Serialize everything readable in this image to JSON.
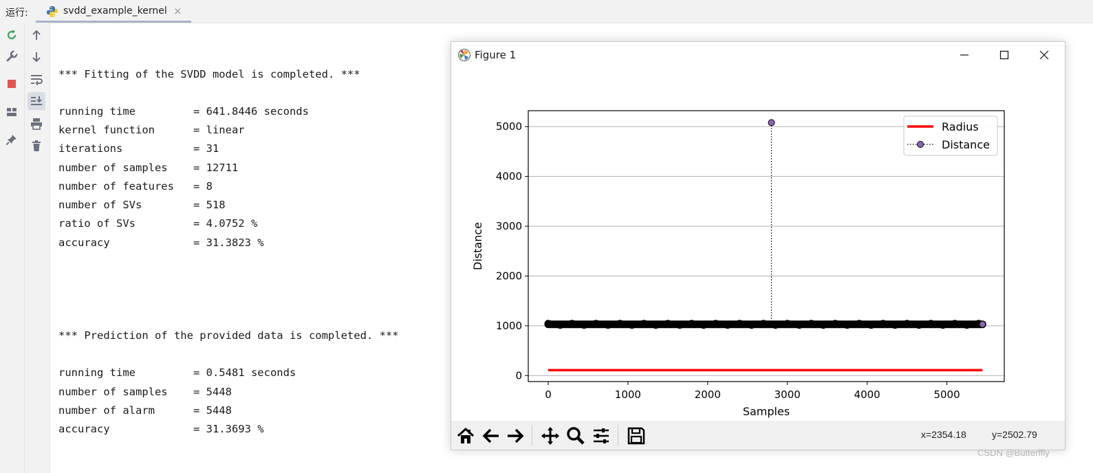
{
  "run_panel": {
    "label": "运行:",
    "tab": {
      "title": "svdd_example_kernel",
      "close": "×"
    }
  },
  "toolbar_left": [
    "rerun-icon",
    "wrench-icon",
    "stop-icon",
    "layout-icon",
    "pin-icon"
  ],
  "toolbar_right": [
    "arrow-up-icon",
    "arrow-down-icon",
    "soft-wrap-icon",
    "scroll-to-end-icon",
    "print-icon",
    "trash-icon"
  ],
  "console": {
    "fit_header": "*** Fitting of the SVDD model is completed. ***",
    "fit_lines": [
      "running time         = 641.8446 seconds",
      "kernel function      = linear",
      "iterations           = 31",
      "number of samples    = 12711",
      "number of features   = 8",
      "number of SVs        = 518",
      "ratio of SVs         = 4.0752 %",
      "accuracy             = 31.3823 %"
    ],
    "pred_header": "*** Prediction of the provided data is completed. ***",
    "pred_lines": [
      "running time         = 0.5481 seconds",
      "number of samples    = 5448",
      "number of alarm      = 5448",
      "accuracy             = 31.3693 %"
    ]
  },
  "figure": {
    "title": "Figure 1",
    "coords": {
      "x": "x=2354.18",
      "y": "y=2502.79"
    },
    "toolbar": [
      "home-icon",
      "back-icon",
      "forward-icon",
      "pan-icon",
      "zoom-icon",
      "configure-icon",
      "save-icon"
    ]
  },
  "chart_data": {
    "type": "line",
    "xlabel": "Samples",
    "ylabel": "Distance",
    "xlim": [
      -250,
      5720
    ],
    "ylim": [
      -120,
      5320
    ],
    "xticks": [
      0,
      1000,
      2000,
      3000,
      4000,
      5000
    ],
    "yticks": [
      0,
      1000,
      2000,
      3000,
      4000,
      5000
    ],
    "grid": "horizontal",
    "legend_position": "upper right",
    "series": [
      {
        "name": "Radius",
        "style": "solid",
        "color": "#ff0000",
        "x": [
          0,
          5447
        ],
        "y": [
          110,
          110
        ]
      },
      {
        "name": "Distance",
        "style": "dotted with circle markers",
        "color": "#000000",
        "marker_color": "#8b68b0",
        "x_range": [
          0,
          5447
        ],
        "baseline": 1030,
        "spike": {
          "x": 2800,
          "y": 5080
        },
        "last_point": {
          "x": 5447,
          "y": 1030
        }
      }
    ]
  },
  "watermark": "CSDN @Butterffly"
}
